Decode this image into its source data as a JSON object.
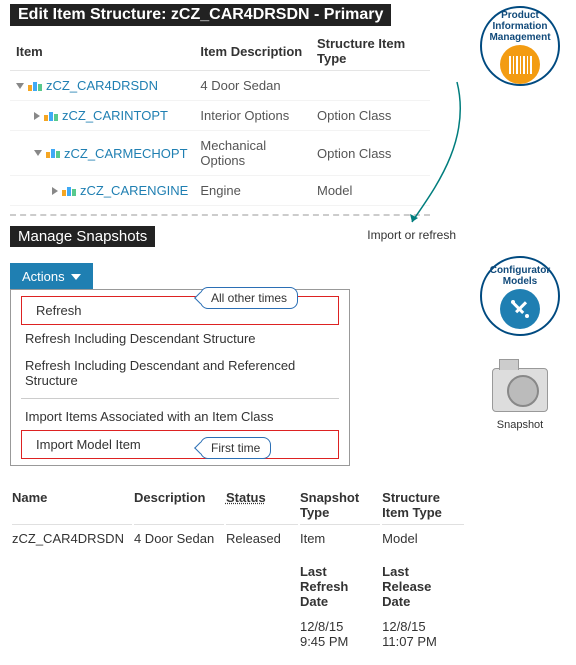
{
  "top": {
    "title": "Edit Item Structure: zCZ_CAR4DRSDN - Primary",
    "headers": {
      "item": "Item",
      "desc": "Item Description",
      "type": "Structure Item Type"
    },
    "rows": [
      {
        "expander": "expanded",
        "indent": 0,
        "name": "zCZ_CAR4DRSDN",
        "desc": "4 Door Sedan",
        "type": ""
      },
      {
        "expander": "collapsed",
        "indent": 1,
        "name": "zCZ_CARINTOPT",
        "desc": "Interior Options",
        "type": "Option Class"
      },
      {
        "expander": "expanded",
        "indent": 1,
        "name": "zCZ_CARMECHOPT",
        "desc": "Mechanical Options",
        "type": "Option Class"
      },
      {
        "expander": "collapsed",
        "indent": 2,
        "name": "zCZ_CARENGINE",
        "desc": "Engine",
        "type": "Model"
      }
    ]
  },
  "arrow_label": "Import or refresh",
  "side": {
    "pim": {
      "line1": "Product",
      "line2": "Information",
      "line3": "Management"
    },
    "config": {
      "line1": "Configurator",
      "line2": "Models"
    },
    "snapshot": "Snapshot"
  },
  "snapshots": {
    "title": "Manage Snapshots",
    "actions_label": "Actions",
    "menu": {
      "refresh": "Refresh",
      "refresh_desc": "Refresh Including Descendant Structure",
      "refresh_desc_ref": "Refresh Including Descendant and Referenced Structure",
      "import_class": "Import Items Associated with an Item Class",
      "import_model": "Import Model Item"
    },
    "callouts": {
      "all_other": "All other times",
      "first_time": "First time"
    },
    "detail": {
      "headers": {
        "name": "Name",
        "desc": "Description",
        "status": "Status",
        "snap_type": "Snapshot Type",
        "struct_type": "Structure Item Type",
        "last_refresh": "Last Refresh Date",
        "last_release": "Last Release Date"
      },
      "row": {
        "name": "zCZ_CAR4DRSDN",
        "desc": "4 Door Sedan",
        "status": "Released",
        "snap_type": "Item",
        "struct_type": "Model",
        "last_refresh": "12/8/15 9:45 PM",
        "last_release": "12/8/15 11:07 PM"
      }
    }
  }
}
